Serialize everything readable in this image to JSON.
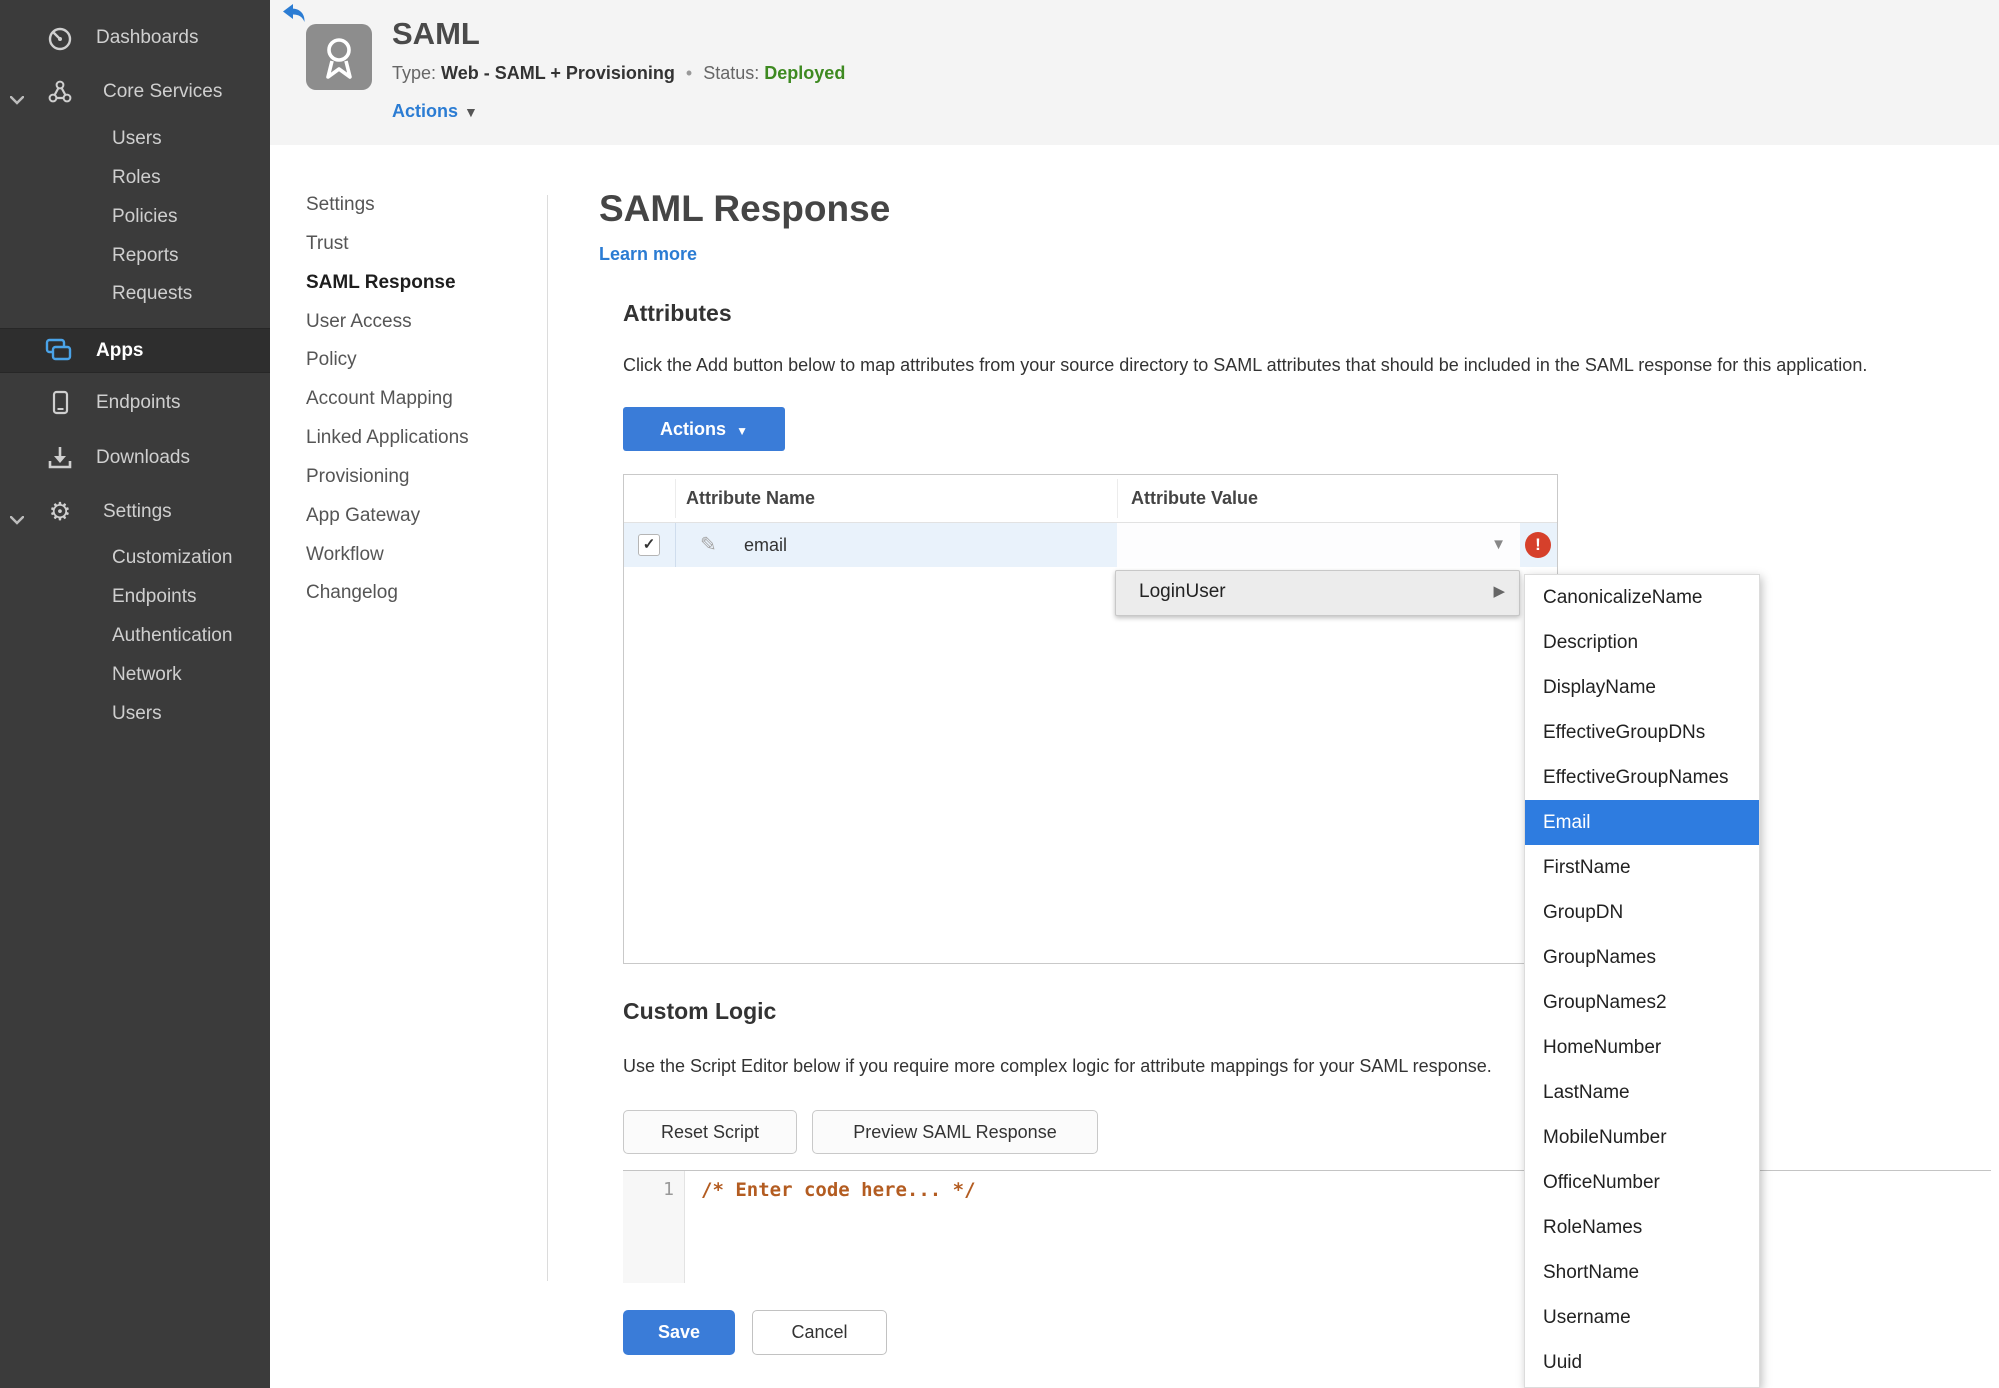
{
  "colors": {
    "accent_blue": "#3a7cd8",
    "link_blue": "#2b7cd3",
    "status_green": "#3e8a21",
    "error_red": "#d6402b",
    "row_highlight": "#e9f2fb",
    "selected_item_blue": "#2e7ce0",
    "sidebar_bg": "#3b3b3b"
  },
  "sidebar": {
    "dashboards": "Dashboards",
    "core_services": "Core Services",
    "core_items": [
      "Users",
      "Roles",
      "Policies",
      "Reports",
      "Requests"
    ],
    "apps": "Apps",
    "endpoints": "Endpoints",
    "downloads": "Downloads",
    "settings": "Settings",
    "settings_items": [
      "Customization",
      "Endpoints",
      "Authentication",
      "Network",
      "Users"
    ]
  },
  "header": {
    "title": "SAML",
    "type_label": "Type:",
    "type_value": "Web - SAML + Provisioning",
    "separator": "•",
    "status_label": "Status:",
    "status_value": "Deployed",
    "actions_label": "Actions"
  },
  "subnav": {
    "items": [
      "Settings",
      "Trust",
      "SAML Response",
      "User Access",
      "Policy",
      "Account Mapping",
      "Linked Applications",
      "Provisioning",
      "App Gateway",
      "Workflow",
      "Changelog"
    ],
    "active": "SAML Response"
  },
  "main": {
    "title": "SAML Response",
    "learn_more": "Learn more",
    "attributes": {
      "heading": "Attributes",
      "description": "Click the Add button below to map attributes from your source directory to SAML attributes that should be included in the SAML response for this application.",
      "actions_button": "Actions",
      "table": {
        "columns": [
          "Attribute Name",
          "Attribute Value"
        ],
        "rows": [
          {
            "name": "email",
            "value": "",
            "checked": "✓",
            "error": "!"
          }
        ]
      }
    },
    "dropdown": {
      "parent": "LoginUser",
      "selected": "Email",
      "items": [
        "CanonicalizeName",
        "Description",
        "DisplayName",
        "EffectiveGroupDNs",
        "EffectiveGroupNames",
        "Email",
        "FirstName",
        "GroupDN",
        "GroupNames",
        "GroupNames2",
        "HomeNumber",
        "LastName",
        "MobileNumber",
        "OfficeNumber",
        "RoleNames",
        "ShortName",
        "Username",
        "Uuid"
      ]
    },
    "custom_logic": {
      "heading": "Custom Logic",
      "description": "Use the Script Editor below if you require more complex logic for attribute mappings for your SAML response.",
      "reset_button": "Reset Script",
      "preview_button": "Preview SAML Response",
      "editor": {
        "line_number": "1",
        "code": "/* Enter code here... */"
      }
    },
    "footer": {
      "save": "Save",
      "cancel": "Cancel"
    }
  }
}
